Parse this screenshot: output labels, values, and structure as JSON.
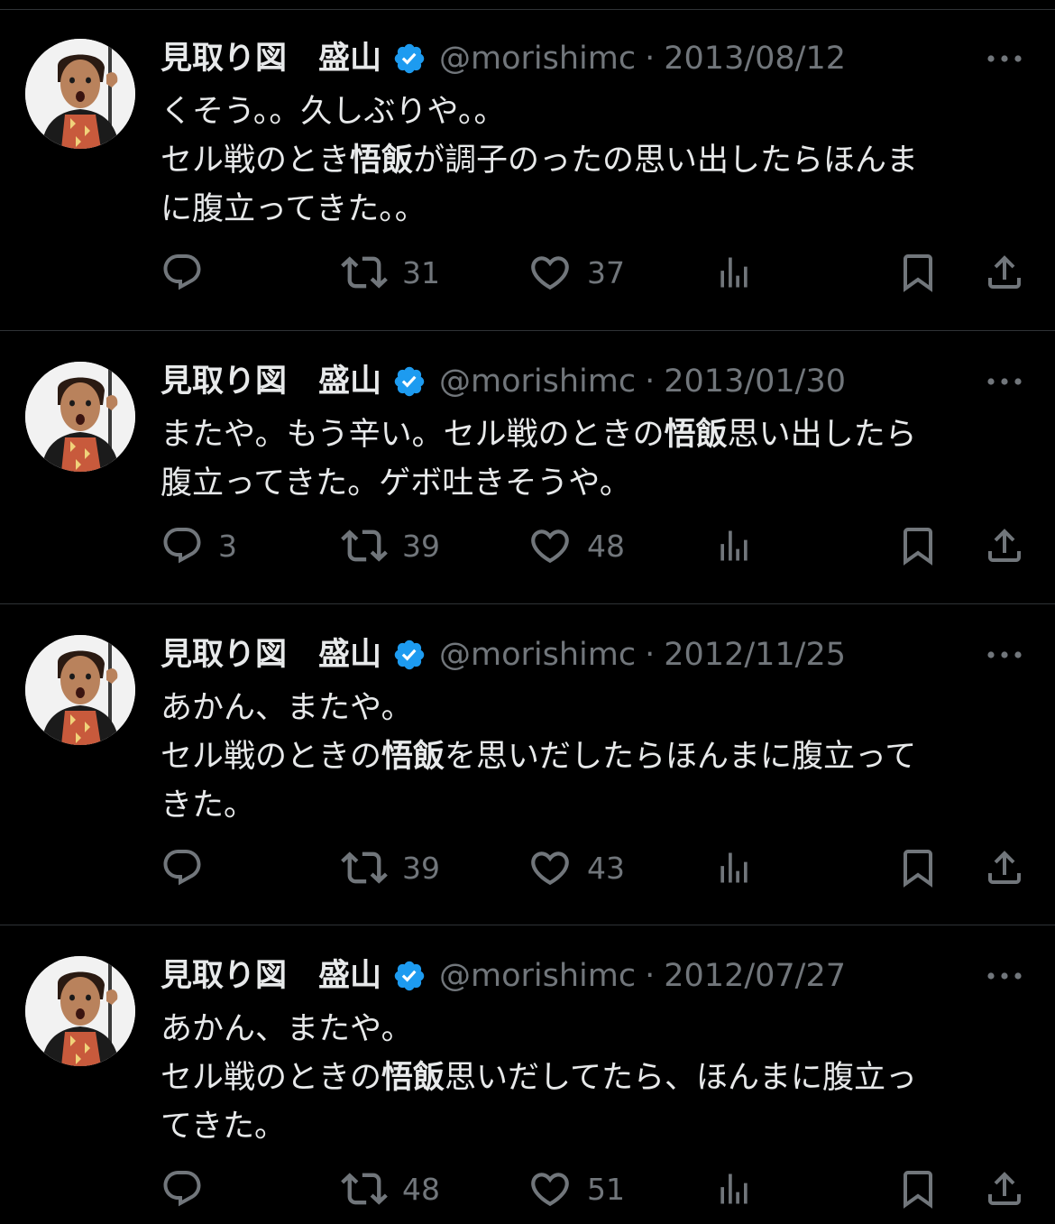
{
  "user": {
    "display_name": "見取り図　盛山",
    "handle": "@morishimc",
    "separator": "·",
    "avatar_icon": "profile-photo",
    "verified_icon": "verified-badge-icon",
    "verified_color": "#1d9bf0"
  },
  "colors": {
    "background": "#000000",
    "text": "#e7e9ea",
    "muted": "#71767b",
    "divider": "#2f3336"
  },
  "tweets": [
    {
      "date": "2013/08/12",
      "lines": [
        [
          {
            "t": "くそう。。久しぶりや。。"
          }
        ],
        [
          {
            "t": "セル戦のとき"
          },
          {
            "t": "悟飯",
            "b": true
          },
          {
            "t": "が調子のったの思い出したらほんま"
          }
        ],
        [
          {
            "t": "に腹立ってきた。。"
          }
        ]
      ],
      "replies": "",
      "retweets": "31",
      "likes": "37"
    },
    {
      "date": "2013/01/30",
      "lines": [
        [
          {
            "t": "またや。もう辛い。セル戦のときの"
          },
          {
            "t": "悟飯",
            "b": true
          },
          {
            "t": "思い出したら"
          }
        ],
        [
          {
            "t": "腹立ってきた。ゲボ吐きそうや。"
          }
        ]
      ],
      "replies": "3",
      "retweets": "39",
      "likes": "48"
    },
    {
      "date": "2012/11/25",
      "lines": [
        [
          {
            "t": "あかん、またや。"
          }
        ],
        [
          {
            "t": "セル戦のときの"
          },
          {
            "t": "悟飯",
            "b": true
          },
          {
            "t": "を思いだしたらほんまに腹立って"
          }
        ],
        [
          {
            "t": "きた。"
          }
        ]
      ],
      "replies": "",
      "retweets": "39",
      "likes": "43"
    },
    {
      "date": "2012/07/27",
      "lines": [
        [
          {
            "t": "あかん、またや。"
          }
        ],
        [
          {
            "t": "セル戦のときの"
          },
          {
            "t": "悟飯",
            "b": true
          },
          {
            "t": "思いだしてたら、ほんまに腹立っ"
          }
        ],
        [
          {
            "t": "てきた。"
          }
        ]
      ],
      "replies": "",
      "retweets": "48",
      "likes": "51"
    }
  ]
}
